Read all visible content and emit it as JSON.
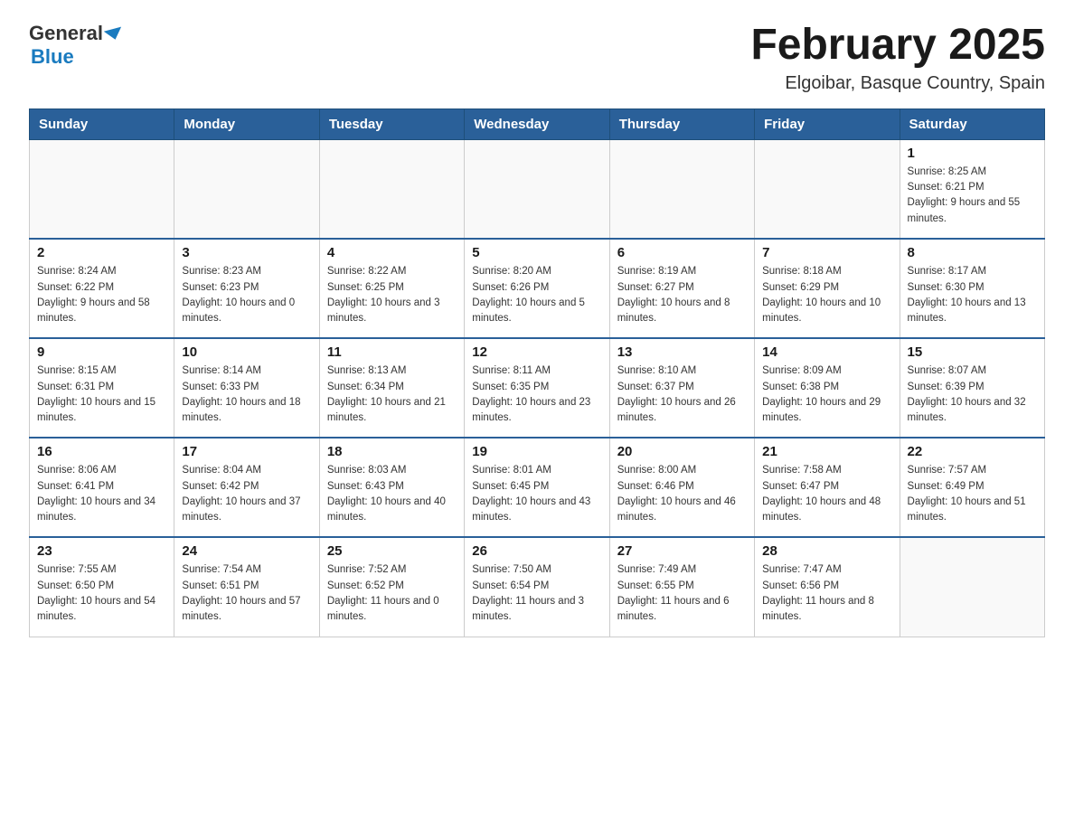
{
  "header": {
    "logo_general": "General",
    "logo_blue": "Blue",
    "month_title": "February 2025",
    "location": "Elgoibar, Basque Country, Spain"
  },
  "weekdays": [
    "Sunday",
    "Monday",
    "Tuesday",
    "Wednesday",
    "Thursday",
    "Friday",
    "Saturday"
  ],
  "weeks": [
    [
      {
        "day": "",
        "sunrise": "",
        "sunset": "",
        "daylight": ""
      },
      {
        "day": "",
        "sunrise": "",
        "sunset": "",
        "daylight": ""
      },
      {
        "day": "",
        "sunrise": "",
        "sunset": "",
        "daylight": ""
      },
      {
        "day": "",
        "sunrise": "",
        "sunset": "",
        "daylight": ""
      },
      {
        "day": "",
        "sunrise": "",
        "sunset": "",
        "daylight": ""
      },
      {
        "day": "",
        "sunrise": "",
        "sunset": "",
        "daylight": ""
      },
      {
        "day": "1",
        "sunrise": "Sunrise: 8:25 AM",
        "sunset": "Sunset: 6:21 PM",
        "daylight": "Daylight: 9 hours and 55 minutes."
      }
    ],
    [
      {
        "day": "2",
        "sunrise": "Sunrise: 8:24 AM",
        "sunset": "Sunset: 6:22 PM",
        "daylight": "Daylight: 9 hours and 58 minutes."
      },
      {
        "day": "3",
        "sunrise": "Sunrise: 8:23 AM",
        "sunset": "Sunset: 6:23 PM",
        "daylight": "Daylight: 10 hours and 0 minutes."
      },
      {
        "day": "4",
        "sunrise": "Sunrise: 8:22 AM",
        "sunset": "Sunset: 6:25 PM",
        "daylight": "Daylight: 10 hours and 3 minutes."
      },
      {
        "day": "5",
        "sunrise": "Sunrise: 8:20 AM",
        "sunset": "Sunset: 6:26 PM",
        "daylight": "Daylight: 10 hours and 5 minutes."
      },
      {
        "day": "6",
        "sunrise": "Sunrise: 8:19 AM",
        "sunset": "Sunset: 6:27 PM",
        "daylight": "Daylight: 10 hours and 8 minutes."
      },
      {
        "day": "7",
        "sunrise": "Sunrise: 8:18 AM",
        "sunset": "Sunset: 6:29 PM",
        "daylight": "Daylight: 10 hours and 10 minutes."
      },
      {
        "day": "8",
        "sunrise": "Sunrise: 8:17 AM",
        "sunset": "Sunset: 6:30 PM",
        "daylight": "Daylight: 10 hours and 13 minutes."
      }
    ],
    [
      {
        "day": "9",
        "sunrise": "Sunrise: 8:15 AM",
        "sunset": "Sunset: 6:31 PM",
        "daylight": "Daylight: 10 hours and 15 minutes."
      },
      {
        "day": "10",
        "sunrise": "Sunrise: 8:14 AM",
        "sunset": "Sunset: 6:33 PM",
        "daylight": "Daylight: 10 hours and 18 minutes."
      },
      {
        "day": "11",
        "sunrise": "Sunrise: 8:13 AM",
        "sunset": "Sunset: 6:34 PM",
        "daylight": "Daylight: 10 hours and 21 minutes."
      },
      {
        "day": "12",
        "sunrise": "Sunrise: 8:11 AM",
        "sunset": "Sunset: 6:35 PM",
        "daylight": "Daylight: 10 hours and 23 minutes."
      },
      {
        "day": "13",
        "sunrise": "Sunrise: 8:10 AM",
        "sunset": "Sunset: 6:37 PM",
        "daylight": "Daylight: 10 hours and 26 minutes."
      },
      {
        "day": "14",
        "sunrise": "Sunrise: 8:09 AM",
        "sunset": "Sunset: 6:38 PM",
        "daylight": "Daylight: 10 hours and 29 minutes."
      },
      {
        "day": "15",
        "sunrise": "Sunrise: 8:07 AM",
        "sunset": "Sunset: 6:39 PM",
        "daylight": "Daylight: 10 hours and 32 minutes."
      }
    ],
    [
      {
        "day": "16",
        "sunrise": "Sunrise: 8:06 AM",
        "sunset": "Sunset: 6:41 PM",
        "daylight": "Daylight: 10 hours and 34 minutes."
      },
      {
        "day": "17",
        "sunrise": "Sunrise: 8:04 AM",
        "sunset": "Sunset: 6:42 PM",
        "daylight": "Daylight: 10 hours and 37 minutes."
      },
      {
        "day": "18",
        "sunrise": "Sunrise: 8:03 AM",
        "sunset": "Sunset: 6:43 PM",
        "daylight": "Daylight: 10 hours and 40 minutes."
      },
      {
        "day": "19",
        "sunrise": "Sunrise: 8:01 AM",
        "sunset": "Sunset: 6:45 PM",
        "daylight": "Daylight: 10 hours and 43 minutes."
      },
      {
        "day": "20",
        "sunrise": "Sunrise: 8:00 AM",
        "sunset": "Sunset: 6:46 PM",
        "daylight": "Daylight: 10 hours and 46 minutes."
      },
      {
        "day": "21",
        "sunrise": "Sunrise: 7:58 AM",
        "sunset": "Sunset: 6:47 PM",
        "daylight": "Daylight: 10 hours and 48 minutes."
      },
      {
        "day": "22",
        "sunrise": "Sunrise: 7:57 AM",
        "sunset": "Sunset: 6:49 PM",
        "daylight": "Daylight: 10 hours and 51 minutes."
      }
    ],
    [
      {
        "day": "23",
        "sunrise": "Sunrise: 7:55 AM",
        "sunset": "Sunset: 6:50 PM",
        "daylight": "Daylight: 10 hours and 54 minutes."
      },
      {
        "day": "24",
        "sunrise": "Sunrise: 7:54 AM",
        "sunset": "Sunset: 6:51 PM",
        "daylight": "Daylight: 10 hours and 57 minutes."
      },
      {
        "day": "25",
        "sunrise": "Sunrise: 7:52 AM",
        "sunset": "Sunset: 6:52 PM",
        "daylight": "Daylight: 11 hours and 0 minutes."
      },
      {
        "day": "26",
        "sunrise": "Sunrise: 7:50 AM",
        "sunset": "Sunset: 6:54 PM",
        "daylight": "Daylight: 11 hours and 3 minutes."
      },
      {
        "day": "27",
        "sunrise": "Sunrise: 7:49 AM",
        "sunset": "Sunset: 6:55 PM",
        "daylight": "Daylight: 11 hours and 6 minutes."
      },
      {
        "day": "28",
        "sunrise": "Sunrise: 7:47 AM",
        "sunset": "Sunset: 6:56 PM",
        "daylight": "Daylight: 11 hours and 8 minutes."
      },
      {
        "day": "",
        "sunrise": "",
        "sunset": "",
        "daylight": ""
      }
    ]
  ]
}
